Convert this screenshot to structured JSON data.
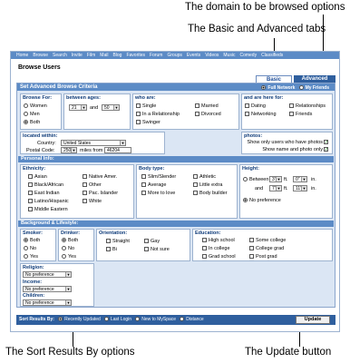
{
  "callouts": {
    "domain": "The domain to be browsed options",
    "tabs": "The Basic and Advanced tabs",
    "sort": "The Sort Results By options",
    "update": "The Update button"
  },
  "navbar": [
    "Home",
    "Browse",
    "Search",
    "Invite",
    "Film",
    "Mail",
    "Blog",
    "Favorites",
    "Forum",
    "Groups",
    "Events",
    "Videos",
    "Music",
    "Comedy",
    "Classifieds"
  ],
  "page_title": "Browse Users",
  "tabs": {
    "basic": "Basic",
    "advanced": "Advanced"
  },
  "panel": {
    "title": "Set Advanced Browse Criteria",
    "network_options": [
      "Full Network",
      "My Friends"
    ]
  },
  "browse_for": {
    "label": "Browse For:",
    "options": [
      "Women",
      "Men",
      "Both"
    ]
  },
  "ages": {
    "label": "between ages:",
    "min": "21",
    "and": "and",
    "max": "50"
  },
  "who_are": {
    "label": "who are:",
    "col1": [
      "Single",
      "In a Relationship",
      "Swinger"
    ],
    "col2": [
      "Married",
      "Divorced"
    ]
  },
  "here_for": {
    "label": "and are here for:",
    "col1": [
      "Dating",
      "Networking"
    ],
    "col2": [
      "Relationships",
      "Friends"
    ]
  },
  "location": {
    "label": "located within:",
    "country_label": "Country:",
    "country": "United States",
    "postal_label": "Postal Code:",
    "distance": "250",
    "miles_from": "miles from",
    "postal_code": "46204"
  },
  "photos": {
    "label": "photos:",
    "options": [
      "Show only users who have photos",
      "Show name and photo only"
    ]
  },
  "personal_info": {
    "heading": "Personal Info:",
    "ethnicity_label": "Ethnicity:",
    "ethnicity_col1": [
      "Asian",
      "Black/African",
      "East Indian",
      "Latino/Hispanic",
      "Middle Eastern"
    ],
    "ethnicity_col2": [
      "Native Amer.",
      "Other",
      "Pac. Islander",
      "White"
    ],
    "body_label": "Body type:",
    "body_col1": [
      "Slim/Slender",
      "Average",
      "More to love"
    ],
    "body_col2": [
      "Athletic",
      "Little extra",
      "Body builder"
    ],
    "height_label": "Height:",
    "between": "Between",
    "ft": "ft.",
    "in": "in.",
    "and": "and",
    "h1_ft": "3'",
    "h1_in": "0\"",
    "h2_ft": "7'",
    "h2_in": "11\"",
    "no_pref": "No preference"
  },
  "background": {
    "heading": "Background & Lifestyle:",
    "smoker_label": "Smoker:",
    "drinker_label": "Drinker:",
    "yn_options": [
      "Both",
      "No",
      "Yes"
    ],
    "orientation_label": "Orientation:",
    "orientation_col1": [
      "Straight",
      "Bi"
    ],
    "orientation_col2": [
      "Gay",
      "Not sure"
    ],
    "education_label": "Education:",
    "education_col1": [
      "High school",
      "In college",
      "Grad school"
    ],
    "education_col2": [
      "Some college",
      "College grad",
      "Post grad"
    ],
    "religion_label": "Religion:",
    "income_label": "Income:",
    "children_label": "Children:",
    "no_preference": "No preference"
  },
  "sort": {
    "label": "Sort Results By:",
    "options": [
      "Recently Updated",
      "Last Login",
      "New to MySpace",
      "Distance"
    ]
  },
  "update_label": "Update"
}
